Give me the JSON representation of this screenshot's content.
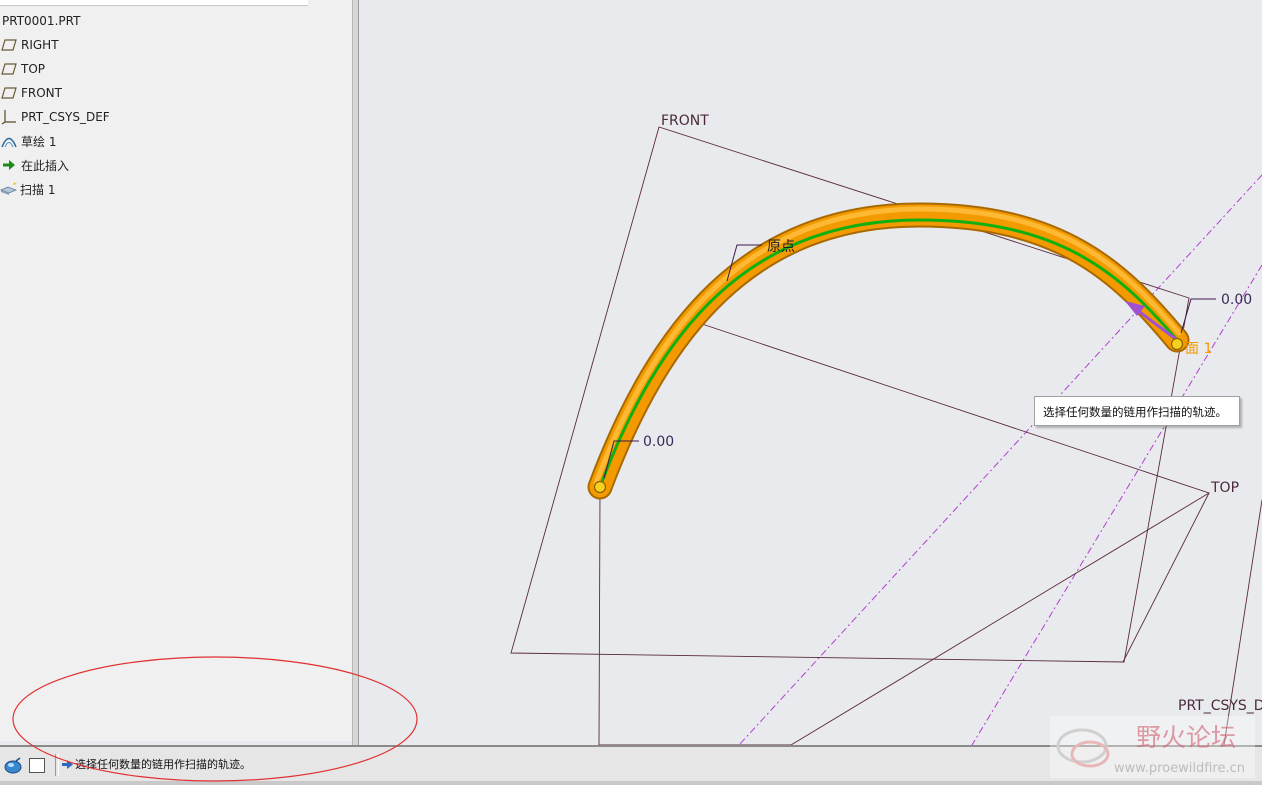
{
  "tree": {
    "items": [
      {
        "label": "PRT0001.PRT",
        "icon": "part-icon"
      },
      {
        "label": "RIGHT",
        "icon": "datum-plane-icon"
      },
      {
        "label": "TOP",
        "icon": "datum-plane-icon"
      },
      {
        "label": "FRONT",
        "icon": "datum-plane-icon"
      },
      {
        "label": "PRT_CSYS_DEF",
        "icon": "csys-icon"
      },
      {
        "label": "草绘 1",
        "icon": "sketch-icon"
      },
      {
        "label": "在此插入",
        "icon": "insert-here-arrow-icon"
      },
      {
        "label": "扫描 1",
        "icon": "sweep-icon"
      }
    ]
  },
  "viewport": {
    "labels": {
      "front": "FRONT",
      "top": "TOP",
      "csys": "PRT_CSYS_D",
      "origin": "原点",
      "start_value": "0.00",
      "end_value": "0.00",
      "section": "面 1"
    },
    "tooltip": "选择任何数量的链用作扫描的轨迹。",
    "colors": {
      "sweep": "#f29a00",
      "trajectory": "#10b010",
      "datum": "#5a2a3a",
      "axis": "#b040d0",
      "direction_arrow": "#a050d0"
    }
  },
  "status": {
    "message": "选择任何数量的链用作扫描的轨迹。"
  },
  "watermark": {
    "title": "野火论坛",
    "url": "www.proewildfire.cn"
  }
}
